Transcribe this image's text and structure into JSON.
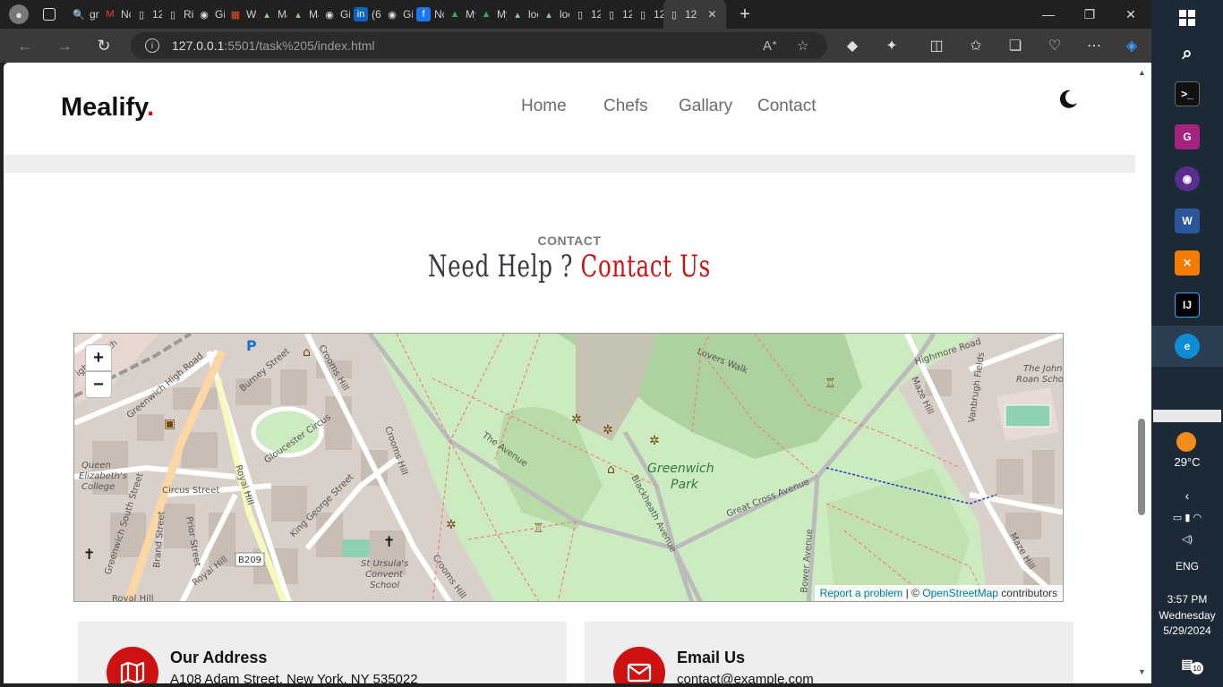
{
  "browser": {
    "tabs": [
      {
        "label": "gn",
        "icon": "search-icon"
      },
      {
        "label": "Nc",
        "icon": "gmail-icon"
      },
      {
        "label": "12",
        "icon": "page-icon"
      },
      {
        "label": "Ris",
        "icon": "page-icon"
      },
      {
        "label": "Gi",
        "icon": "github-icon"
      },
      {
        "label": "Wi",
        "icon": "microsoft-icon"
      },
      {
        "label": "Ma",
        "icon": "app-icon"
      },
      {
        "label": "Ma",
        "icon": "app-icon"
      },
      {
        "label": "Gi",
        "icon": "github-icon"
      },
      {
        "label": "(6)",
        "icon": "linkedin-icon"
      },
      {
        "label": "Gi",
        "icon": "github-icon"
      },
      {
        "label": "Nc",
        "icon": "facebook-icon"
      },
      {
        "label": "My",
        "icon": "drive-icon"
      },
      {
        "label": "My",
        "icon": "drive-icon"
      },
      {
        "label": "loc",
        "icon": "app-icon"
      },
      {
        "label": "loc",
        "icon": "app-icon"
      },
      {
        "label": "12",
        "icon": "page-icon"
      },
      {
        "label": "12",
        "icon": "page-icon"
      },
      {
        "label": "12",
        "icon": "page-icon"
      }
    ],
    "active_tab": {
      "label": "12",
      "icon": "page-icon"
    },
    "url_host": "127.0.0.1",
    "url_rest": ":5501/task%205/index.html"
  },
  "site": {
    "logo": "Mealify",
    "logo_dot": ".",
    "nav": [
      "Home",
      "Chefs",
      "Gallary",
      "Contact"
    ]
  },
  "contact": {
    "subtitle": "CONTACT",
    "title_plain": "Need Help ? ",
    "title_accent": "Contact Us"
  },
  "map": {
    "zoom_in": "+",
    "zoom_out": "−",
    "attribution_link1": "Report a problem",
    "attribution_sep": " | © ",
    "attribution_link2": "OpenStreetMap",
    "attribution_tail": " contributors",
    "labels": {
      "park": "Greenwich",
      "park2": "Park",
      "avenue": "The Avenue",
      "blackheath": "Blackheath Avenue",
      "great_cross": "Great Cross Avenue",
      "lovers": "Lovers Walk",
      "crooms": "Crooms Hill",
      "crooms2": "Crooms Hill",
      "crooms3": "Crooms Hill",
      "gloucester": "Gloucester Circus",
      "circus": "Circus Street",
      "king_george": "King George Street",
      "royal_hill": "Royal Hill",
      "royal_hill2": "Royal Hill",
      "greenwich_south": "Greenwich South Street",
      "brand": "Brand Street",
      "prior": "Prior Street",
      "b209": "B209",
      "st_ursula1": "St Ursula's",
      "st_ursula2": "Convent",
      "st_ursula3": "School",
      "queen1": "Queen",
      "queen2": "Elizabeth's",
      "queen3": "College",
      "highmore": "Highmore Road",
      "maze": "Maze Hill",
      "maze2": "Maze Hill",
      "vanbrugh": "Vanbrugh Fields",
      "john_roan1": "The John",
      "john_roan2": "Roan Schoo",
      "burney": "Burney Street",
      "greenwich_high": "Greenwich High Road",
      "bower": "Bower Avenue",
      "royal_hill3": "Royal Hill",
      "deptford": "ightsmouth"
    }
  },
  "cards": [
    {
      "title": "Our Address",
      "value": "A108 Adam Street, New York, NY 535022",
      "icon": "map-icon"
    },
    {
      "title": "Email Us",
      "value": "contact@example.com",
      "icon": "envelope-icon"
    }
  ],
  "taskbar": {
    "weather_temp": "29°C",
    "lang": "ENG",
    "time": "3:57 PM",
    "day": "Wednesday",
    "date": "5/29/2024",
    "notif_count": "10"
  },
  "colors": {
    "accent": "#ce1212",
    "park": "#cdebc1",
    "taskbar": "#1c2a38"
  }
}
